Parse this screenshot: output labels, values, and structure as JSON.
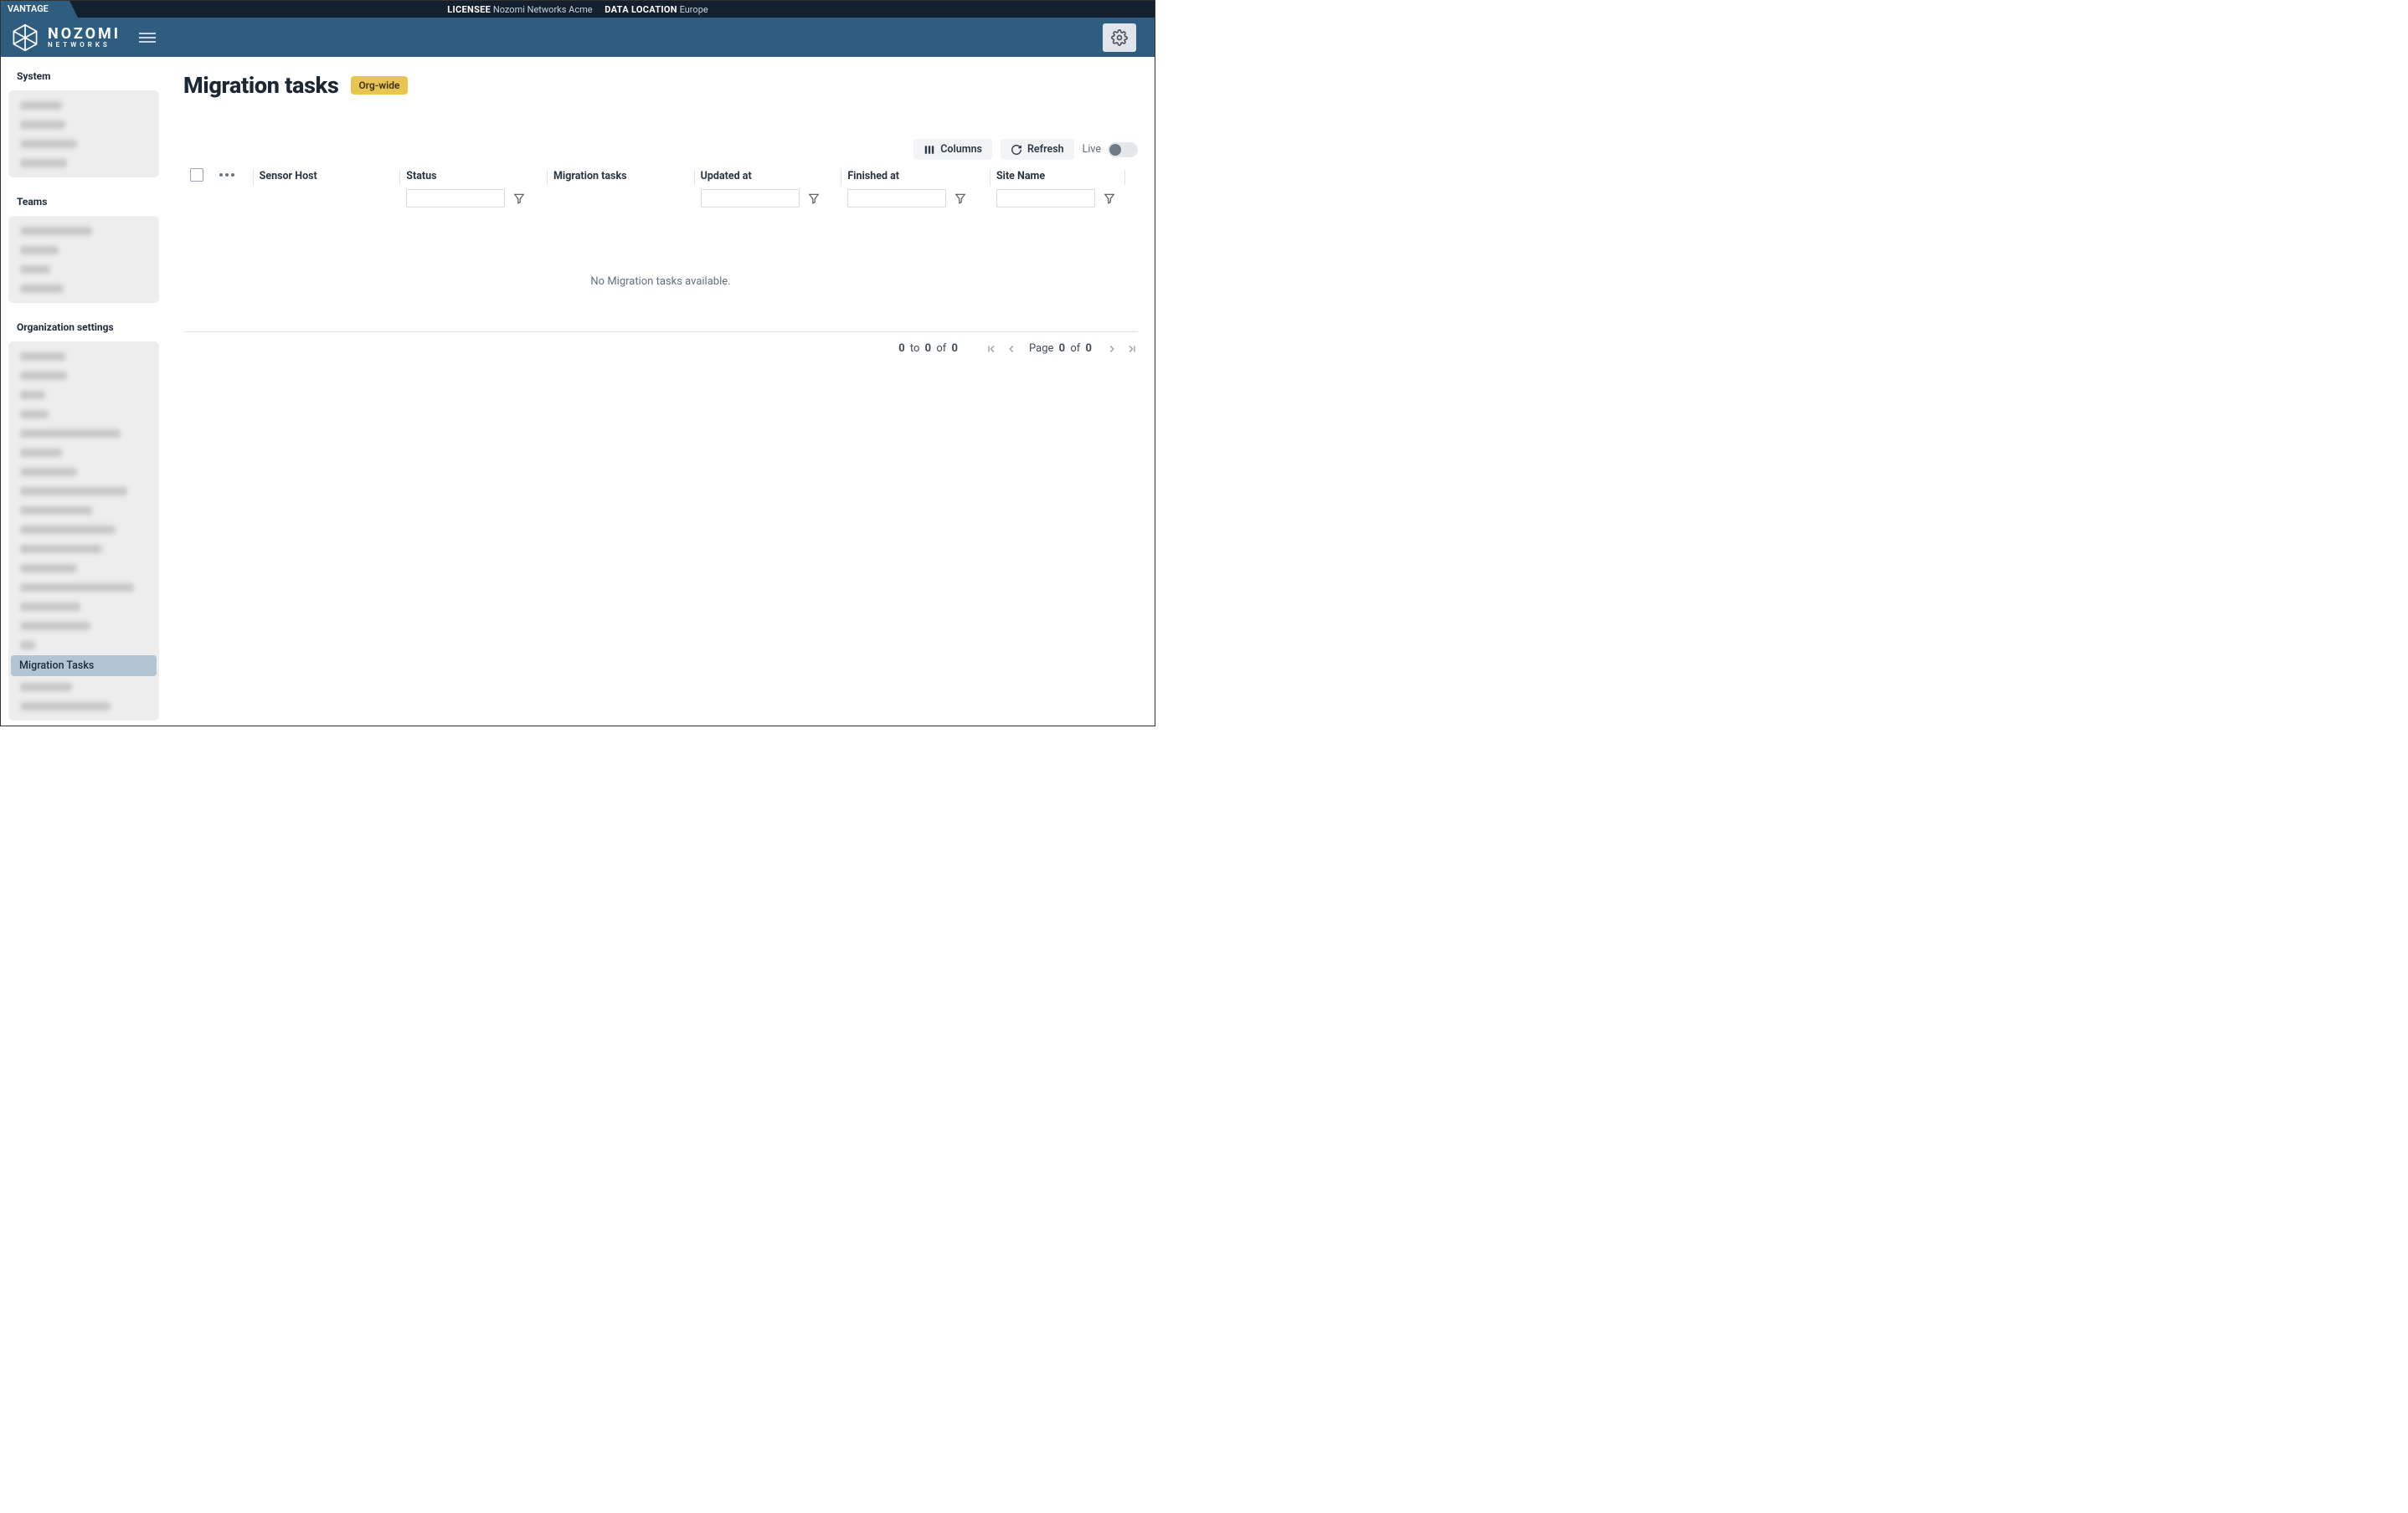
{
  "topbar": {
    "tab": "VANTAGE",
    "licensee_label": "LICENSEE",
    "licensee_value": "Nozomi Networks Acme",
    "data_loc_label": "DATA LOCATION",
    "data_loc_value": "Europe"
  },
  "logo": {
    "line1": "NOZOMI",
    "line2": "NETWORKS"
  },
  "sidebar": {
    "sections": {
      "system": {
        "title": "System",
        "blurs": [
          50,
          54,
          68,
          56
        ]
      },
      "teams": {
        "title": "Teams",
        "blurs": [
          86,
          46,
          36,
          52
        ]
      },
      "org": {
        "title": "Organization settings",
        "blurs_before": [
          54,
          56,
          30,
          34,
          120,
          50,
          68,
          128,
          86,
          114,
          98,
          68,
          136,
          72,
          84,
          18
        ],
        "active_label": "Migration Tasks",
        "blurs_after": [
          62,
          108
        ]
      }
    }
  },
  "page": {
    "title": "Migration tasks",
    "badge": "Org-wide"
  },
  "toolbar": {
    "columns": "Columns",
    "refresh": "Refresh",
    "live": "Live"
  },
  "table": {
    "headers": {
      "sensor_host": "Sensor Host",
      "status": "Status",
      "migration_tasks": "Migration tasks",
      "updated_at": "Updated at",
      "finished_at": "Finished at",
      "site_name": "Site Name"
    },
    "empty": "No Migration tasks available."
  },
  "pagination": {
    "from": "0",
    "to": "0",
    "of_word": "of",
    "to_word": "to",
    "total": "0",
    "page_word": "Page",
    "page_current": "0",
    "page_total": "0"
  }
}
